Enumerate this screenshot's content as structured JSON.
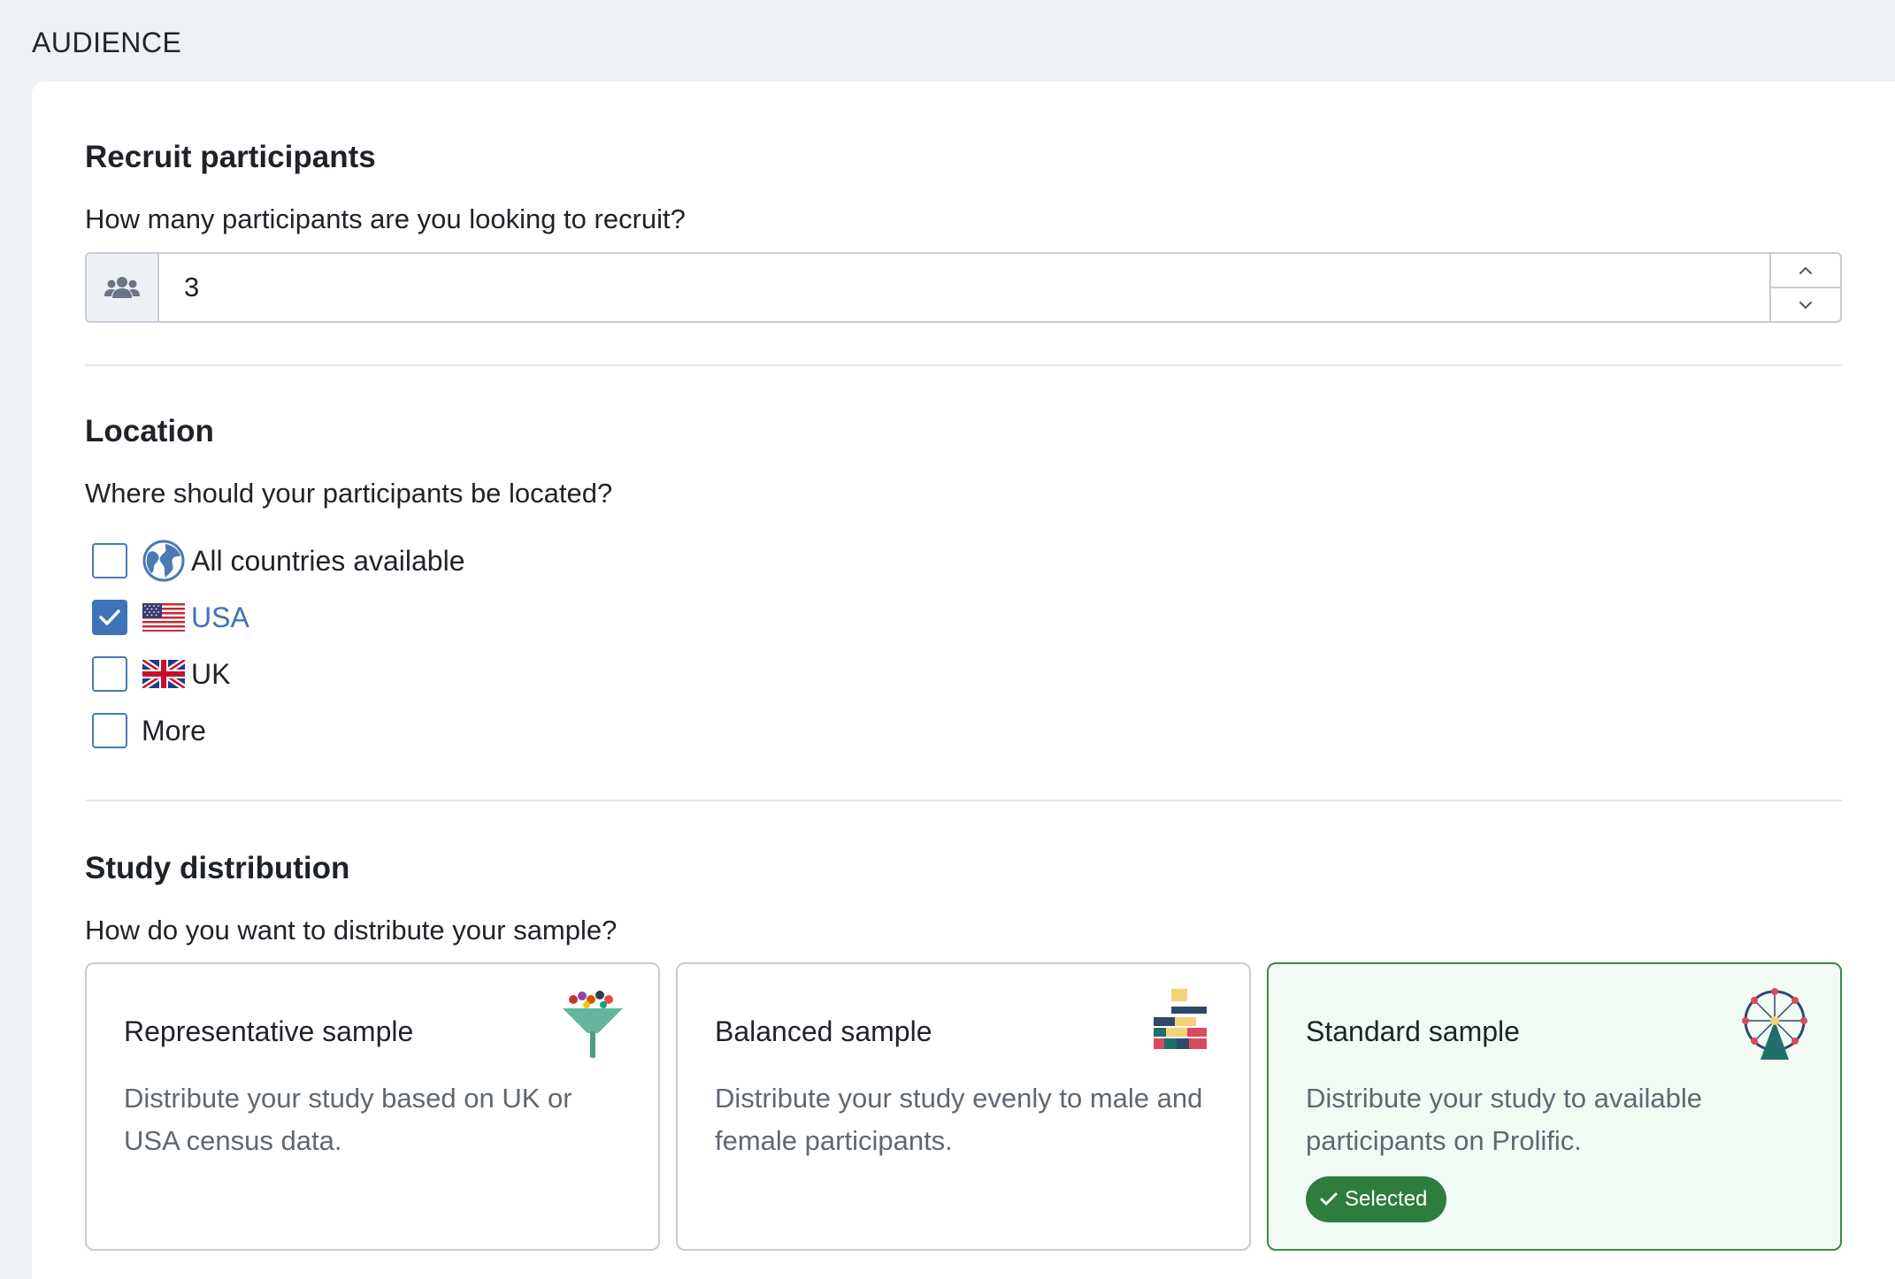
{
  "section": {
    "title": "AUDIENCE"
  },
  "recruit": {
    "heading": "Recruit participants",
    "question": "How many participants are you looking to recruit?",
    "value": "3",
    "prefix_icon": "users-icon"
  },
  "location": {
    "heading": "Location",
    "question": "Where should your participants be located?",
    "options": [
      {
        "label": "All countries available",
        "checked": false,
        "icon": "globe-icon"
      },
      {
        "label": "USA",
        "checked": true,
        "icon": "us-flag-icon"
      },
      {
        "label": "UK",
        "checked": false,
        "icon": "uk-flag-icon"
      },
      {
        "label": "More",
        "checked": false
      }
    ]
  },
  "distribution": {
    "heading": "Study distribution",
    "question": "How do you want to distribute your sample?",
    "cards": [
      {
        "title": "Representative sample",
        "description": "Distribute your study based on UK or USA census data.",
        "selected": false,
        "icon": "funnel-illustration"
      },
      {
        "title": "Balanced sample",
        "description": "Distribute your study evenly to male and female participants.",
        "selected": false,
        "icon": "blocks-illustration"
      },
      {
        "title": "Standard sample",
        "description": "Distribute your study to available participants on Prolific.",
        "selected": true,
        "badge": "Selected",
        "icon": "ferris-wheel-illustration"
      }
    ]
  },
  "colors": {
    "accent": "#3e73b8",
    "selected_border": "#3a8a4c",
    "selected_badge": "#2f7d3e"
  }
}
